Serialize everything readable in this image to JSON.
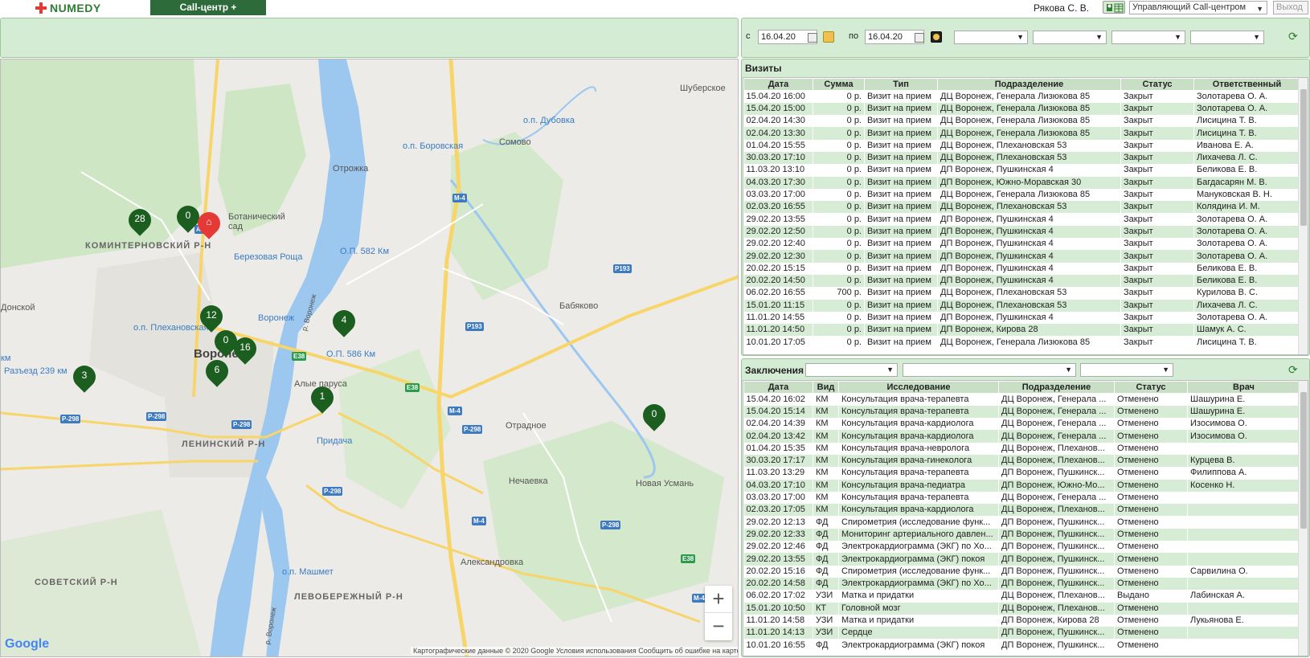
{
  "app": {
    "logo": "NUMEDY",
    "main_tab": "Call-центр +",
    "user_name": "Рякова С. В.",
    "role": "Управляющий Call-центром",
    "exit": "Выход",
    "brand_color": "#2e6b3a"
  },
  "filters": {
    "from_label": "с",
    "from_date": "16.04.20",
    "to_label": "по",
    "to_date": "16.04.20",
    "selects": [
      "",
      "",
      "",
      ""
    ]
  },
  "map": {
    "labels": {
      "shuberskoe": "Шуберское",
      "dubovka": "о.п. Дубовка",
      "borovskaya": "о.п. Боровская",
      "somovo": "Сомово",
      "otrozhka": "Отрожка",
      "botsad": "Ботанический сад",
      "komintern": "КОМИНТЕРНОВСКИЙ Р-Н",
      "berezovaya": "Березовая Роща",
      "op582": "О.П. 582 Км",
      "donskoy": "Донской",
      "plekhanovskaya": "о.п. Плехановская",
      "voronezh_st": "Воронеж",
      "voronezh_city": "Воронеж",
      "babyakovo": "Бабяково",
      "op586": "О.П. 586 Км",
      "razezd": "Разъезд 239 км",
      "km": "км",
      "alye_parusa": "Алые паруса",
      "otradnoe": "Отрадное",
      "leninsky": "ЛЕНИНСКИЙ Р-Н",
      "pridacha": "Придача",
      "nechaevka": "Нечаевка",
      "novaya_usman": "Новая Усмань",
      "aleksandrovka": "Александровка",
      "sovetsky": "СОВЕТСКИЙ Р-Н",
      "mashmet": "о.п. Машмет",
      "levoberezhny": "ЛЕВОБЕРЕЖНЫЙ Р-Н",
      "river_voronezh": "р. Воронеж",
      "river_voronezh2": "р. Воронеж"
    },
    "road_signs": {
      "m4a": "М-4",
      "m4b": "М-4",
      "m4c": "М-4",
      "m4d": "М-4",
      "p193a": "Р193",
      "p193b": "Р193",
      "e38a": "Е38",
      "e38b": "Е38",
      "e38c": "Е38",
      "p298a": "Р-298",
      "p298b": "Р-298",
      "p298c": "Р-298",
      "p298d": "Р-298",
      "p298e": "Р-298",
      "p298f": "Р-298",
      "a1": "А1"
    },
    "markers": {
      "m28": "28",
      "m0a": "0",
      "m12": "12",
      "m0b": "0",
      "m16": "16",
      "m6": "6",
      "m4": "4",
      "m3": "3",
      "m1": "1",
      "m0c": "0"
    },
    "zoom_in": "+",
    "zoom_out": "−",
    "google": "Google",
    "attribution": "Картографические данные © 2020 Google     Условия использования     Сообщить об ошибке на карте"
  },
  "visits": {
    "title": "Визиты",
    "columns": [
      "Дата",
      "Сумма",
      "Тип",
      "Подразделение",
      "Статус",
      "Ответственный"
    ],
    "rows": [
      [
        "15.04.20 16:00",
        "0 р.",
        "Визит на прием",
        "ДЦ Воронеж, Генерала Лизюкова 85",
        "Закрыт",
        "Золотарева О. А."
      ],
      [
        "15.04.20 15:00",
        "0 р.",
        "Визит на прием",
        "ДЦ Воронеж, Генерала Лизюкова 85",
        "Закрыт",
        "Золотарева О. А."
      ],
      [
        "02.04.20 14:30",
        "0 р.",
        "Визит на прием",
        "ДЦ Воронеж, Генерала Лизюкова 85",
        "Закрыт",
        "Лисицина Т. В."
      ],
      [
        "02.04.20 13:30",
        "0 р.",
        "Визит на прием",
        "ДЦ Воронеж, Генерала Лизюкова 85",
        "Закрыт",
        "Лисицина Т. В."
      ],
      [
        "01.04.20 15:55",
        "0 р.",
        "Визит на прием",
        "ДЦ Воронеж, Плехановская 53",
        "Закрыт",
        "Иванова Е. А."
      ],
      [
        "30.03.20 17:10",
        "0 р.",
        "Визит на прием",
        "ДЦ Воронеж, Плехановская 53",
        "Закрыт",
        "Лихачева Л. С."
      ],
      [
        "11.03.20 13:10",
        "0 р.",
        "Визит на прием",
        "ДП Воронеж, Пушкинская 4",
        "Закрыт",
        "Беликова Е. В."
      ],
      [
        "04.03.20 17:30",
        "0 р.",
        "Визит на прием",
        "ДП Воронеж, Южно-Моравская 30",
        "Закрыт",
        "Багдасарян М. В."
      ],
      [
        "03.03.20 17:00",
        "0 р.",
        "Визит на прием",
        "ДЦ Воронеж, Генерала Лизюкова 85",
        "Закрыт",
        "Мануковская В. Н."
      ],
      [
        "02.03.20 16:55",
        "0 р.",
        "Визит на прием",
        "ДЦ Воронеж, Плехановская 53",
        "Закрыт",
        "Колядина И. М."
      ],
      [
        "29.02.20 13:55",
        "0 р.",
        "Визит на прием",
        "ДП Воронеж, Пушкинская 4",
        "Закрыт",
        "Золотарева О. А."
      ],
      [
        "29.02.20 12:50",
        "0 р.",
        "Визит на прием",
        "ДП Воронеж, Пушкинская 4",
        "Закрыт",
        "Золотарева О. А."
      ],
      [
        "29.02.20 12:40",
        "0 р.",
        "Визит на прием",
        "ДП Воронеж, Пушкинская 4",
        "Закрыт",
        "Золотарева О. А."
      ],
      [
        "29.02.20 12:30",
        "0 р.",
        "Визит на прием",
        "ДП Воронеж, Пушкинская 4",
        "Закрыт",
        "Золотарева О. А."
      ],
      [
        "20.02.20 15:15",
        "0 р.",
        "Визит на прием",
        "ДП Воронеж, Пушкинская 4",
        "Закрыт",
        "Беликова Е. В."
      ],
      [
        "20.02.20 14:50",
        "0 р.",
        "Визит на прием",
        "ДП Воронеж, Пушкинская 4",
        "Закрыт",
        "Беликова Е. В."
      ],
      [
        "06.02.20 16:55",
        "700 р.",
        "Визит на прием",
        "ДЦ Воронеж, Плехановская 53",
        "Закрыт",
        "Курилова В. С."
      ],
      [
        "15.01.20 11:15",
        "0 р.",
        "Визит на прием",
        "ДЦ Воронеж, Плехановская 53",
        "Закрыт",
        "Лихачева Л. С."
      ],
      [
        "11.01.20 14:55",
        "0 р.",
        "Визит на прием",
        "ДП Воронеж, Пушкинская 4",
        "Закрыт",
        "Золотарева О. А."
      ],
      [
        "11.01.20 14:50",
        "0 р.",
        "Визит на прием",
        "ДП Воронеж, Кирова 28",
        "Закрыт",
        "Шамук А. С."
      ],
      [
        "10.01.20 17:05",
        "0 р.",
        "Визит на прием",
        "ДЦ Воронеж, Генерала Лизюкова 85",
        "Закрыт",
        "Лисицина Т. В."
      ]
    ]
  },
  "conclusions": {
    "title": "Заключения",
    "filters": [
      "",
      "",
      ""
    ],
    "columns": [
      "Дата",
      "Вид",
      "Исследование",
      "Подразделение",
      "Статус",
      "Врач"
    ],
    "rows": [
      [
        "15.04.20 16:02",
        "КМ",
        "Консультация врача-терапевта",
        "ДЦ Воронеж, Генерала ...",
        "Отменено",
        "Шашурина Е."
      ],
      [
        "15.04.20 15:14",
        "КМ",
        "Консультация врача-терапевта",
        "ДЦ Воронеж, Генерала ...",
        "Отменено",
        "Шашурина Е."
      ],
      [
        "02.04.20 14:39",
        "КМ",
        "Консультация врача-кардиолога",
        "ДЦ Воронеж, Генерала ...",
        "Отменено",
        "Изосимова О."
      ],
      [
        "02.04.20 13:42",
        "КМ",
        "Консультация врача-кардиолога",
        "ДЦ Воронеж, Генерала ...",
        "Отменено",
        "Изосимова О."
      ],
      [
        "01.04.20 15:35",
        "КМ",
        "Консультация врача-невролога",
        "ДЦ Воронеж, Плеханов...",
        "Отменено",
        ""
      ],
      [
        "30.03.20 17:17",
        "КМ",
        "Консультация врача-гинеколога",
        "ДЦ Воронеж, Плеханов...",
        "Отменено",
        "Курцева В."
      ],
      [
        "11.03.20 13:29",
        "КМ",
        "Консультация врача-терапевта",
        "ДП Воронеж, Пушкинск...",
        "Отменено",
        "Филиппова А."
      ],
      [
        "04.03.20 17:10",
        "КМ",
        "Консультация врача-педиатра",
        "ДП Воронеж, Южно-Мо...",
        "Отменено",
        "Косенко Н."
      ],
      [
        "03.03.20 17:00",
        "КМ",
        "Консультация врача-терапевта",
        "ДЦ Воронеж, Генерала ...",
        "Отменено",
        ""
      ],
      [
        "02.03.20 17:05",
        "КМ",
        "Консультация врача-кардиолога",
        "ДЦ Воронеж, Плеханов...",
        "Отменено",
        ""
      ],
      [
        "29.02.20 12:13",
        "ФД",
        "Спирометрия (исследование функ...",
        "ДП Воронеж, Пушкинск...",
        "Отменено",
        ""
      ],
      [
        "29.02.20 12:33",
        "ФД",
        "Мониторинг артериального давлен...",
        "ДП Воронеж, Пушкинск...",
        "Отменено",
        ""
      ],
      [
        "29.02.20 12:46",
        "ФД",
        "Электрокардиограмма (ЭКГ) по Хо...",
        "ДП Воронеж, Пушкинск...",
        "Отменено",
        ""
      ],
      [
        "29.02.20 13:55",
        "ФД",
        "Электрокардиограмма (ЭКГ) покоя",
        "ДП Воронеж, Пушкинск...",
        "Отменено",
        ""
      ],
      [
        "20.02.20 15:16",
        "ФД",
        "Спирометрия (исследование функ...",
        "ДП Воронеж, Пушкинск...",
        "Отменено",
        "Сарвилина О."
      ],
      [
        "20.02.20 14:58",
        "ФД",
        "Электрокардиограмма (ЭКГ) по Хо...",
        "ДП Воронеж, Пушкинск...",
        "Отменено",
        ""
      ],
      [
        "06.02.20 17:02",
        "УЗИ",
        "Матка и придатки",
        "ДЦ Воронеж, Плеханов...",
        "Выдано",
        "Лабинская А."
      ],
      [
        "15.01.20 10:50",
        "КТ",
        "Головной мозг",
        "ДЦ Воронеж, Плеханов...",
        "Отменено",
        ""
      ],
      [
        "11.01.20 14:58",
        "УЗИ",
        "Матка и придатки",
        "ДП Воронеж, Кирова 28",
        "Отменено",
        "Лукьянова Е."
      ],
      [
        "11.01.20 14:13",
        "УЗИ",
        "Сердце",
        "ДП Воронеж, Пушкинск...",
        "Отменено",
        ""
      ],
      [
        "10.01.20 16:55",
        "ФД",
        "Электрокардиограмма (ЭКГ) покоя",
        "ДП Воронеж, Пушкинск...",
        "Отменено",
        ""
      ]
    ]
  }
}
